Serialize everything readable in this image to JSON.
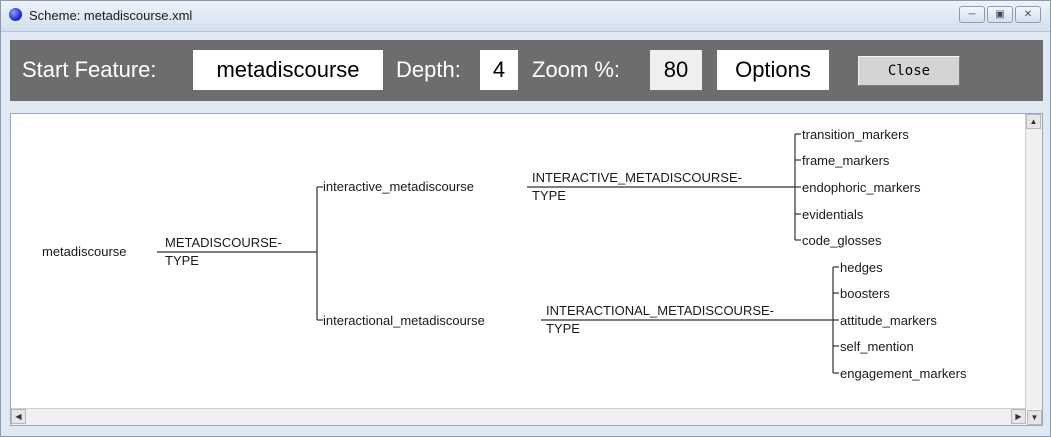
{
  "window": {
    "title": "Scheme: metadiscourse.xml"
  },
  "toolbar": {
    "start_feature_label": "Start Feature:",
    "start_feature_value": "metadiscourse",
    "depth_label": "Depth:",
    "depth_value": "4",
    "zoom_label": "Zoom %:",
    "zoom_value": "80",
    "options_label": "Options",
    "close_label": "Close"
  },
  "tree": {
    "root": "metadiscourse",
    "root_type": [
      "METADISCOURSE-",
      "TYPE"
    ],
    "branches": [
      {
        "feature": "interactive_metadiscourse",
        "type": [
          "INTERACTIVE_METADISCOURSE-",
          "TYPE"
        ],
        "leaves": [
          "transition_markers",
          "frame_markers",
          "endophoric_markers",
          "evidentials",
          "code_glosses"
        ]
      },
      {
        "feature": "interactional_metadiscourse",
        "type": [
          "INTERACTIONAL_METADISCOURSE-",
          "TYPE"
        ],
        "leaves": [
          "hedges",
          "boosters",
          "attitude_markers",
          "self_mention",
          "engagement_markers"
        ]
      }
    ]
  },
  "colors": {
    "toolbar_bg": "#6d6d6d",
    "titlebar": "#dfe8f3"
  },
  "icons": {
    "app": "app-circle-icon",
    "minimize": "minimize-icon",
    "maximize": "maximize-icon",
    "close": "close-icon"
  }
}
